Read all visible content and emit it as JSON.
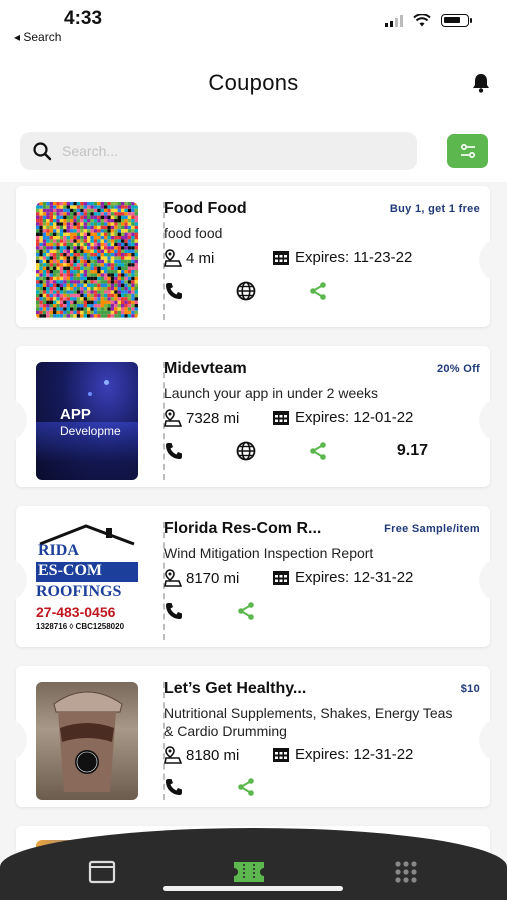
{
  "status": {
    "time": "4:33",
    "back": "◂ Search"
  },
  "header": {
    "title": "Coupons"
  },
  "search": {
    "placeholder": "Search..."
  },
  "coupons": [
    {
      "title": "Food Food",
      "badge": "Buy 1, get 1 free",
      "description": "food food",
      "distance": "4 mi",
      "expires": "Expires: 11-23-22",
      "score": "",
      "thumb": "qr"
    },
    {
      "title": "Midevteam",
      "badge": "20% Off",
      "description": "Launch your app in under 2 weeks",
      "distance": "7328 mi",
      "expires": "Expires: 12-01-22",
      "score": "9.17",
      "thumb": "app",
      "thumb_text1": "APP",
      "thumb_text2": "Developme"
    },
    {
      "title": "Florida Res-Com R...",
      "badge": "Free Sample/item",
      "description": "Wind Mitigation Inspection Report",
      "distance": "8170 mi",
      "expires": "Expires: 12-31-22",
      "score": "",
      "thumb": "roof",
      "thumb_text1": "RIDA",
      "thumb_text2": "ES-COM",
      "thumb_text3": "ROOFINGS",
      "thumb_text4": "27-483-0456",
      "thumb_text5": "1328716 ◊ CBC1258020"
    },
    {
      "title": "Let’s Get Healthy...",
      "badge": "$10",
      "description": "Nutritional Supplements, Shakes, Energy Teas & Cardio Drumming",
      "distance": "8180 mi",
      "expires": "Expires: 12-31-22",
      "score": "",
      "thumb": "shake"
    }
  ],
  "colors": {
    "accent": "#5cb74e",
    "badge": "#1f3a78",
    "tabbar": "#2b2b2b"
  },
  "tabs": [
    {
      "icon": "wallet-icon",
      "active": false
    },
    {
      "icon": "ticket-icon",
      "active": true
    },
    {
      "icon": "grid-icon",
      "active": false
    }
  ]
}
